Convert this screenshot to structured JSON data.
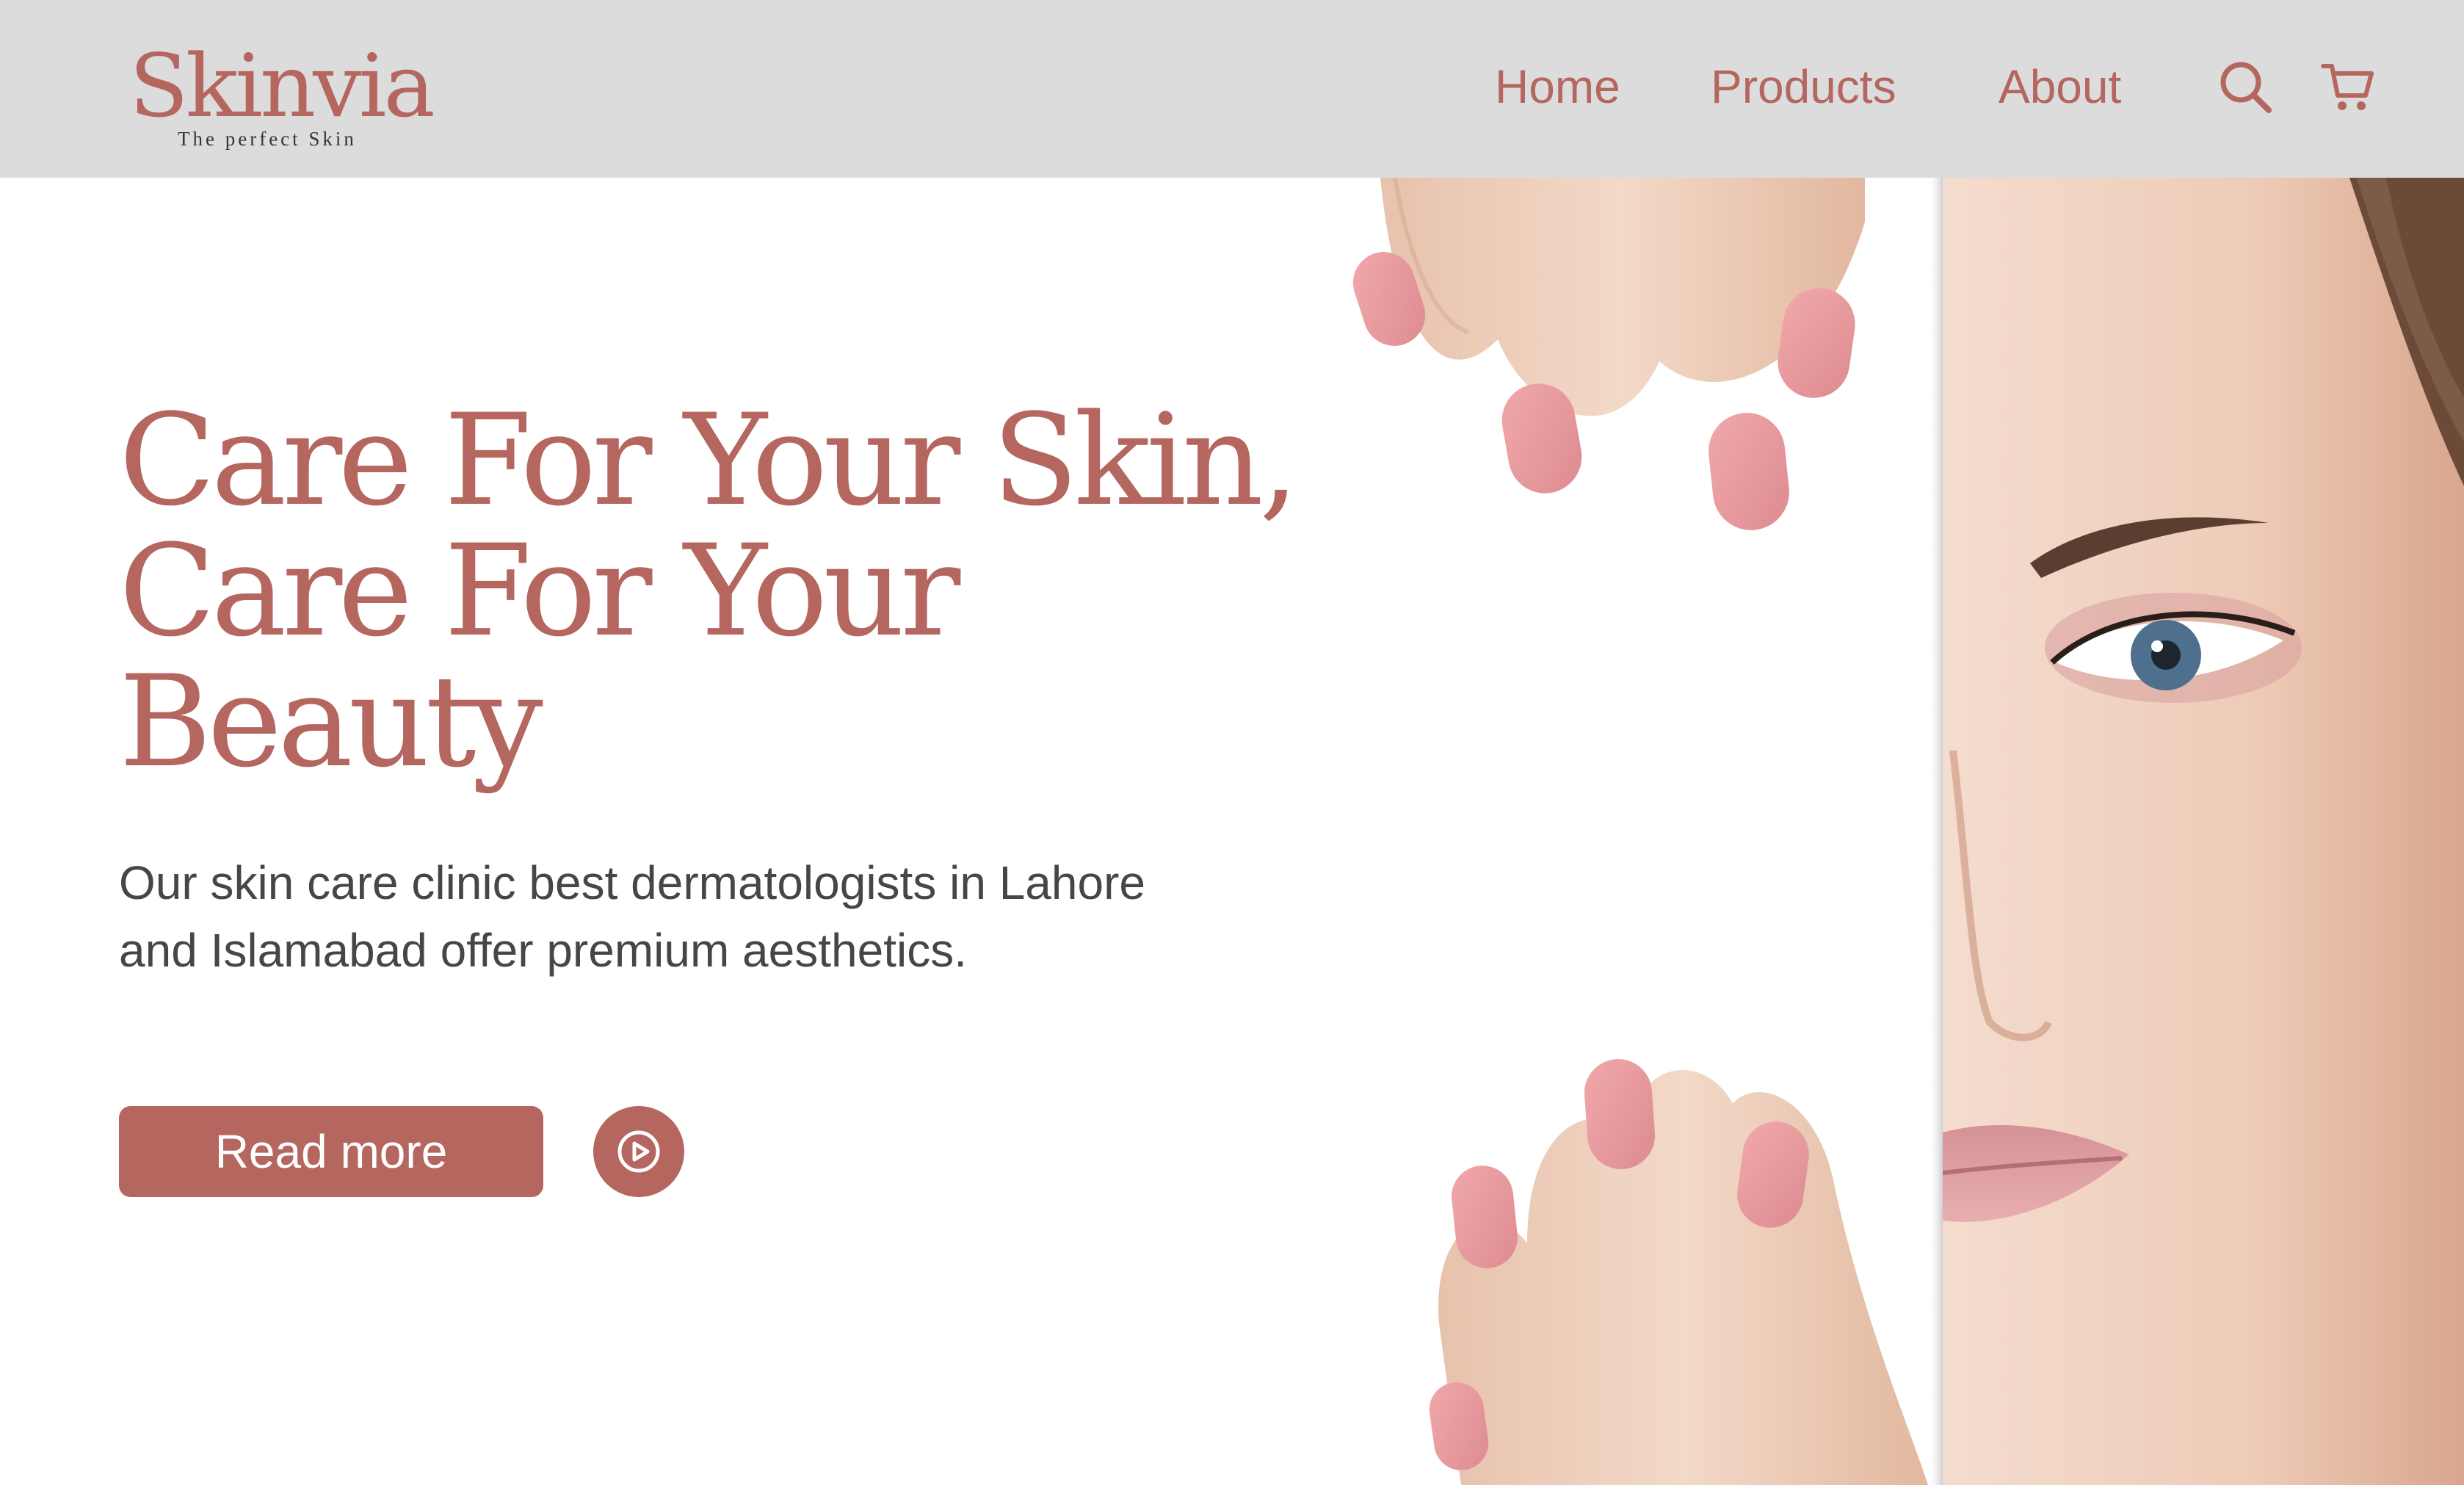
{
  "brand": {
    "name": "Skinvia",
    "tagline": "The perfect Skin"
  },
  "nav": {
    "items": [
      {
        "label": "Home"
      },
      {
        "label": "Products"
      },
      {
        "label": "About"
      }
    ],
    "search_icon": "search-icon",
    "cart_icon": "cart-icon"
  },
  "hero": {
    "headline_lines": [
      "Care For Your Skin,",
      "Care For Your",
      "Beauty"
    ],
    "subtext": "Our skin care clinic best dermatologists in Lahore and Islamabad offer premium aesthetics.",
    "cta_label": "Read more",
    "play_icon": "play-circle-icon",
    "image_subject": "woman-face-with-hands-holding-white-card"
  },
  "colors": {
    "accent": "#b4665f",
    "header_bg": "#dcdcdc",
    "body_text": "#4a4545",
    "background": "#ffffff"
  }
}
